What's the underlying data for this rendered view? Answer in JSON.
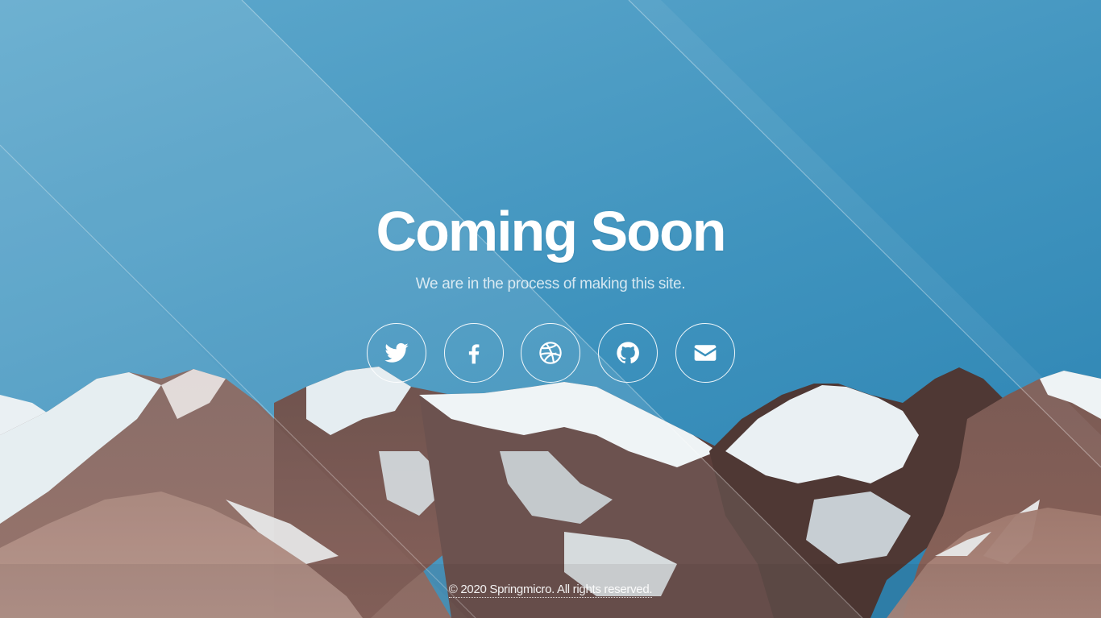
{
  "hero": {
    "title": "Coming Soon",
    "subtitle": "We are in the process of making this site."
  },
  "socials": [
    {
      "name": "twitter",
      "icon": "twitter-icon"
    },
    {
      "name": "facebook",
      "icon": "facebook-icon"
    },
    {
      "name": "dribbble",
      "icon": "dribbble-icon"
    },
    {
      "name": "github",
      "icon": "github-icon"
    },
    {
      "name": "email",
      "icon": "envelope-icon"
    }
  ],
  "footer": {
    "copyright": "© 2020 Springmicro. All rights reserved."
  },
  "colors": {
    "sky_top": "#3a8db8",
    "sky_bottom": "#5aa6cb",
    "snow": "#e6eef2",
    "rock": "#6d4a44",
    "text": "#ffffff"
  }
}
